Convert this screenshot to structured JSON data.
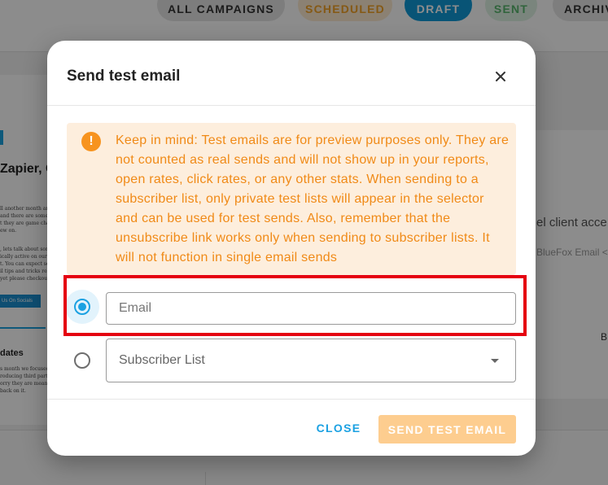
{
  "background": {
    "tabs": [
      {
        "label": "ALL CAMPAIGNS"
      },
      {
        "label": "SCHEDULED"
      },
      {
        "label": "DRAFT"
      },
      {
        "label": "SENT"
      },
      {
        "label": "ARCHIV"
      }
    ],
    "left_card": {
      "heading": "Zapier, C",
      "lines_a": [
        "ll another month an",
        "and there are some f",
        "t they are game char",
        "ew on."
      ],
      "lines_b": [
        ", lets talk about som",
        "ically active on our",
        "t. You can expect se",
        "il tips and tricks rela",
        "yet please checkout"
      ],
      "button_label": "Us On Socials",
      "updates_heading": "dates",
      "lines_c": [
        "s month we focused",
        "roducing third party",
        "orry they are meant",
        "back on it."
      ]
    },
    "right_panel": {
      "client_text": "el client acce",
      "sender_text": "BlueFox Email <",
      "b_text": "B"
    }
  },
  "dialog": {
    "title": "Send test email",
    "close_icon": "close-icon",
    "notice": {
      "icon": "warning-icon",
      "icon_glyph": "!",
      "text": "Keep in mind: Test emails are for preview purposes only. They are not counted as real sends and will not show up in your reports, open rates, click rates, or any other stats. When sending to a subscriber list, only private test lists will appear in the selector and can be used for test sends. Also, remember that the unsubscribe link works only when sending to subscriber lists. It will not function in single email sends"
    },
    "email_option": {
      "placeholder": "Email",
      "value": "",
      "selected": true
    },
    "list_option": {
      "label": "Subscriber List",
      "selected": false
    },
    "footer": {
      "close_label": "CLOSE",
      "send_label": "SEND TEST EMAIL"
    }
  },
  "colors": {
    "accent_blue": "#1ba1e2",
    "notice_bg": "#fdeedd",
    "notice_text": "#f08a17",
    "send_button_disabled": "#fdcd8f",
    "highlight_red": "#e50010"
  }
}
